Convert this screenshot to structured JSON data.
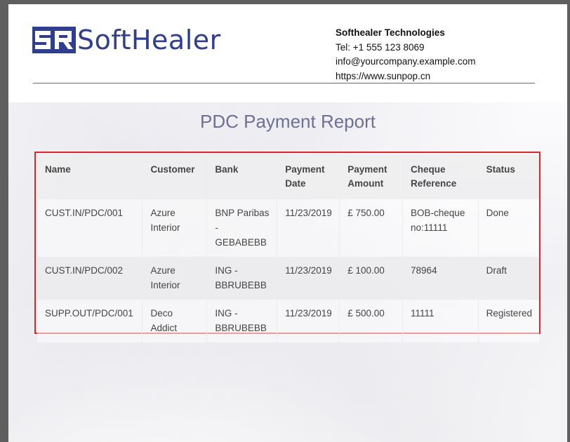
{
  "header": {
    "logo_text": "SoftHealer",
    "company_name": "Softhealer Technologies",
    "phone": "Tel: +1 555 123 8069",
    "email": "info@yourcompany.example.com",
    "website": "https://www.sunpop.cn"
  },
  "report": {
    "title": "PDC Payment Report",
    "columns": [
      "Name",
      "Customer",
      "Bank",
      "Payment Date",
      "Payment Amount",
      "Cheque Reference",
      "Status"
    ],
    "rows": [
      [
        "CUST.IN/PDC/001",
        "Azure Interior",
        "BNP Paribas - GEBABEBB",
        "11/23/2019",
        "£ 750.00",
        "BOB-cheque no:11111",
        "Done"
      ],
      [
        "CUST.IN/PDC/002",
        "Azure Interior",
        "ING - BBRUBEBB",
        "11/23/2019",
        "£ 100.00",
        "78964",
        "Draft"
      ],
      [
        "SUPP.OUT/PDC/001",
        "Deco Addict",
        "ING - BBRUBEBB",
        "11/23/2019",
        "£ 500.00",
        "11111",
        "Registered"
      ]
    ]
  },
  "colors": {
    "brand": "#2f3e8f",
    "title": "#6e6e96",
    "highlight_border": "#e02424"
  }
}
